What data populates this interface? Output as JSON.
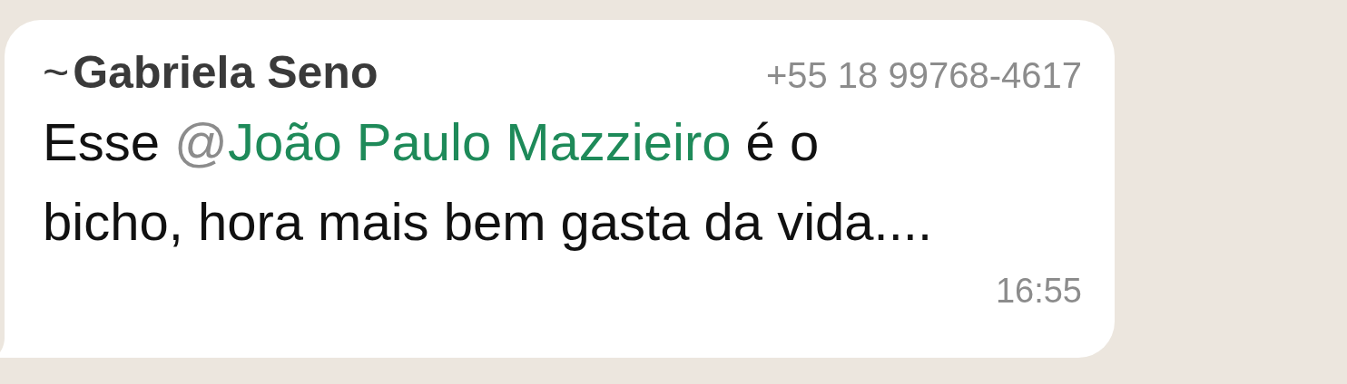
{
  "message": {
    "sender": {
      "tilde": "~",
      "name": "Gabriela Seno",
      "phone": "+55 18 99768-4617"
    },
    "body": [
      {
        "kind": "text",
        "text": "Esse "
      },
      {
        "kind": "mention",
        "at": "@",
        "name": "João Paulo Mazzieiro"
      },
      {
        "kind": "text",
        "text": " é o bicho, hora mais bem gasta da vida...."
      }
    ],
    "time": "16:55"
  }
}
